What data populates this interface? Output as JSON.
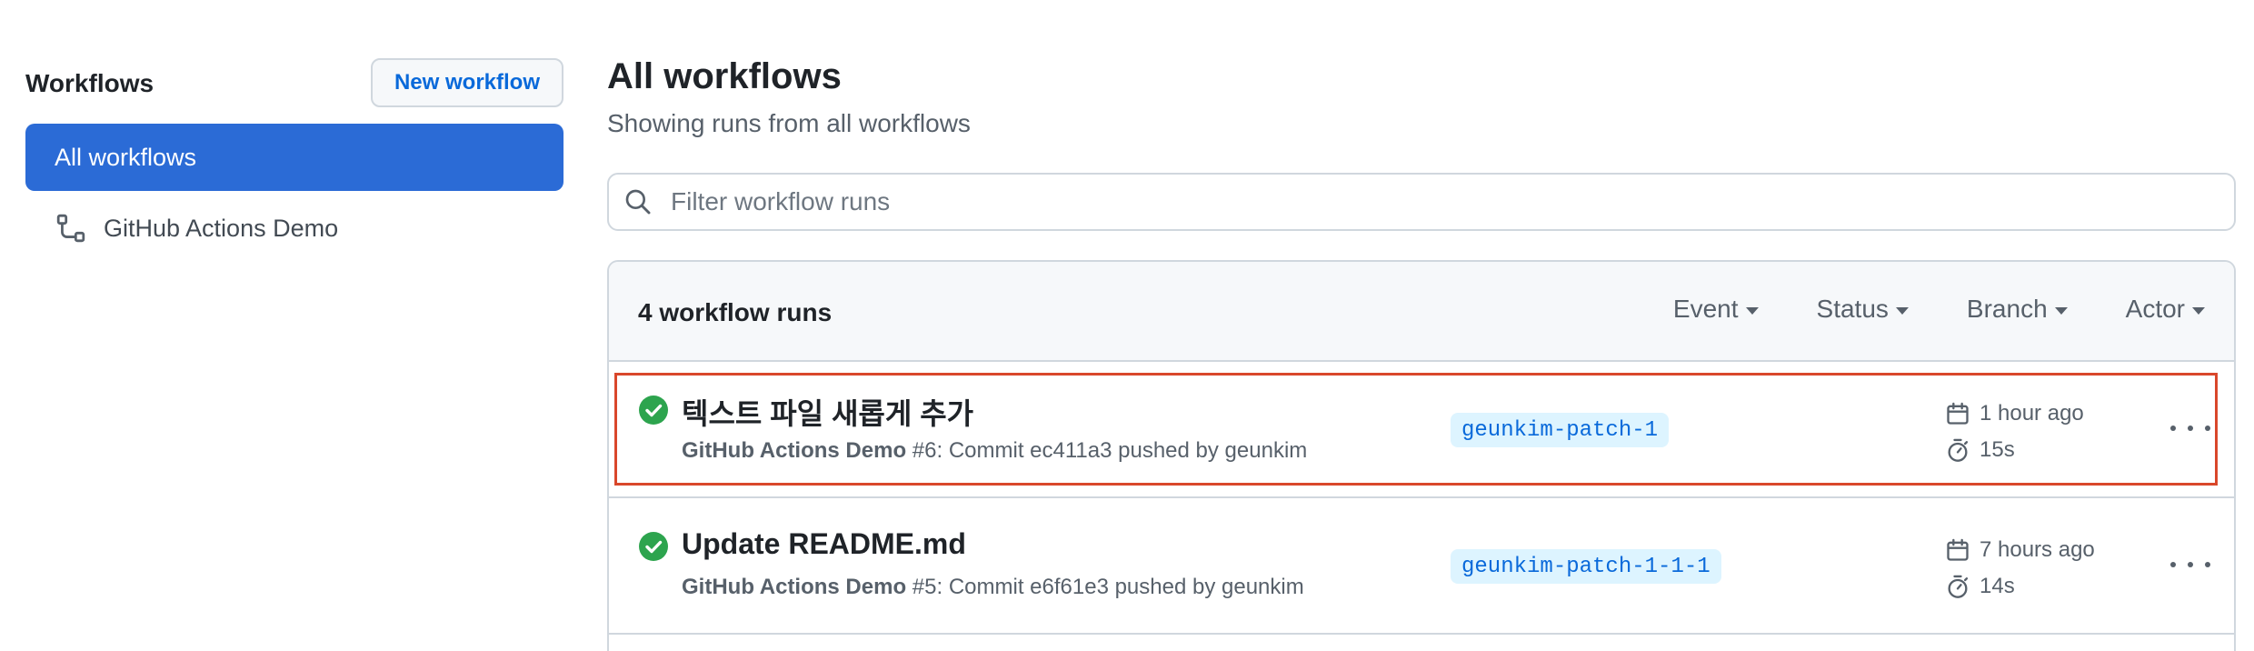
{
  "sidebar": {
    "title": "Workflows",
    "new_workflow_label": "New workflow",
    "items": [
      {
        "label": "All workflows",
        "active": true
      },
      {
        "label": "GitHub Actions Demo",
        "icon": "workflow-icon"
      }
    ]
  },
  "main": {
    "title": "All workflows",
    "subtitle": "Showing runs from all workflows",
    "filter_placeholder": "Filter workflow runs",
    "runs_count": "4 workflow runs",
    "filters": [
      "Event",
      "Status",
      "Branch",
      "Actor"
    ],
    "runs": [
      {
        "title": "텍스트 파일 새롭게 추가",
        "workflow": "GitHub Actions Demo",
        "meta": " #6: Commit ec411a3 pushed by geunkim",
        "branch": "geunkim-patch-1",
        "time": "1 hour ago",
        "duration": "15s",
        "status": "success"
      },
      {
        "title": "Update README.md",
        "workflow": "GitHub Actions Demo",
        "meta": " #5: Commit e6f61e3 pushed by geunkim",
        "branch": "geunkim-patch-1-1-1",
        "time": "7 hours ago",
        "duration": "14s",
        "status": "success"
      }
    ]
  },
  "colors": {
    "accent": "#2b6bd6",
    "link": "#0969da",
    "success": "#2da44e",
    "highlight_border": "#d9472b"
  }
}
